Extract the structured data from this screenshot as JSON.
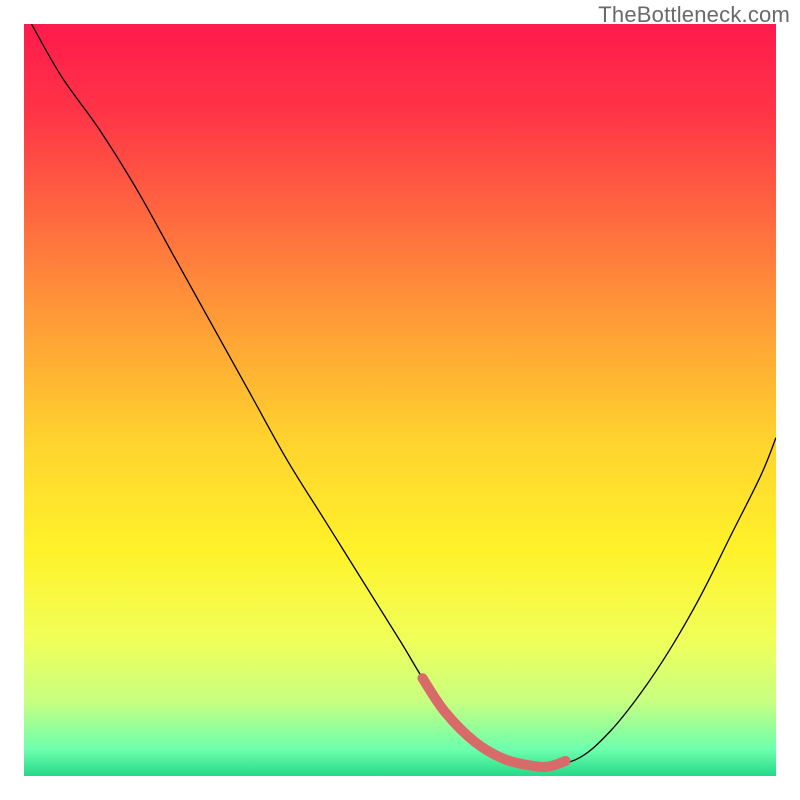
{
  "watermark": "TheBottleneck.com",
  "chart_data": {
    "type": "line",
    "title": "",
    "xlabel": "",
    "ylabel": "",
    "xlim": [
      0,
      100
    ],
    "ylim": [
      0,
      100
    ],
    "grid": false,
    "legend": null,
    "gradient": {
      "direction": "vertical",
      "stops": [
        {
          "offset": 0.0,
          "color": "#ff1a4d"
        },
        {
          "offset": 0.12,
          "color": "#ff3547"
        },
        {
          "offset": 0.35,
          "color": "#ff8c3a"
        },
        {
          "offset": 0.55,
          "color": "#ffd22e"
        },
        {
          "offset": 0.7,
          "color": "#fff22a"
        },
        {
          "offset": 0.82,
          "color": "#f0ff5a"
        },
        {
          "offset": 0.9,
          "color": "#c8ff80"
        },
        {
          "offset": 0.965,
          "color": "#6cffad"
        },
        {
          "offset": 1.0,
          "color": "#25d98a"
        }
      ]
    },
    "series": [
      {
        "name": "bottleneck-curve",
        "color": "#000000",
        "stroke_width": 1.3,
        "x": [
          1,
          5,
          10,
          15,
          20,
          25,
          30,
          35,
          40,
          45,
          50,
          53,
          56,
          60,
          64,
          68,
          70,
          74,
          78,
          82,
          86,
          90,
          94,
          98,
          100
        ],
        "y": [
          100,
          93,
          86,
          78,
          69,
          60,
          51,
          42,
          34,
          26,
          18,
          13,
          8.5,
          4.5,
          2.2,
          1.3,
          1.3,
          2.5,
          6,
          11,
          17,
          24,
          32,
          40,
          45
        ]
      },
      {
        "name": "highlight-band",
        "color": "#d96a6a",
        "stroke_width": 10,
        "linecap": "round",
        "x": [
          53,
          56,
          60,
          64,
          68,
          70,
          72
        ],
        "y": [
          13,
          8.5,
          4.5,
          2.2,
          1.3,
          1.3,
          2.0
        ]
      }
    ]
  }
}
